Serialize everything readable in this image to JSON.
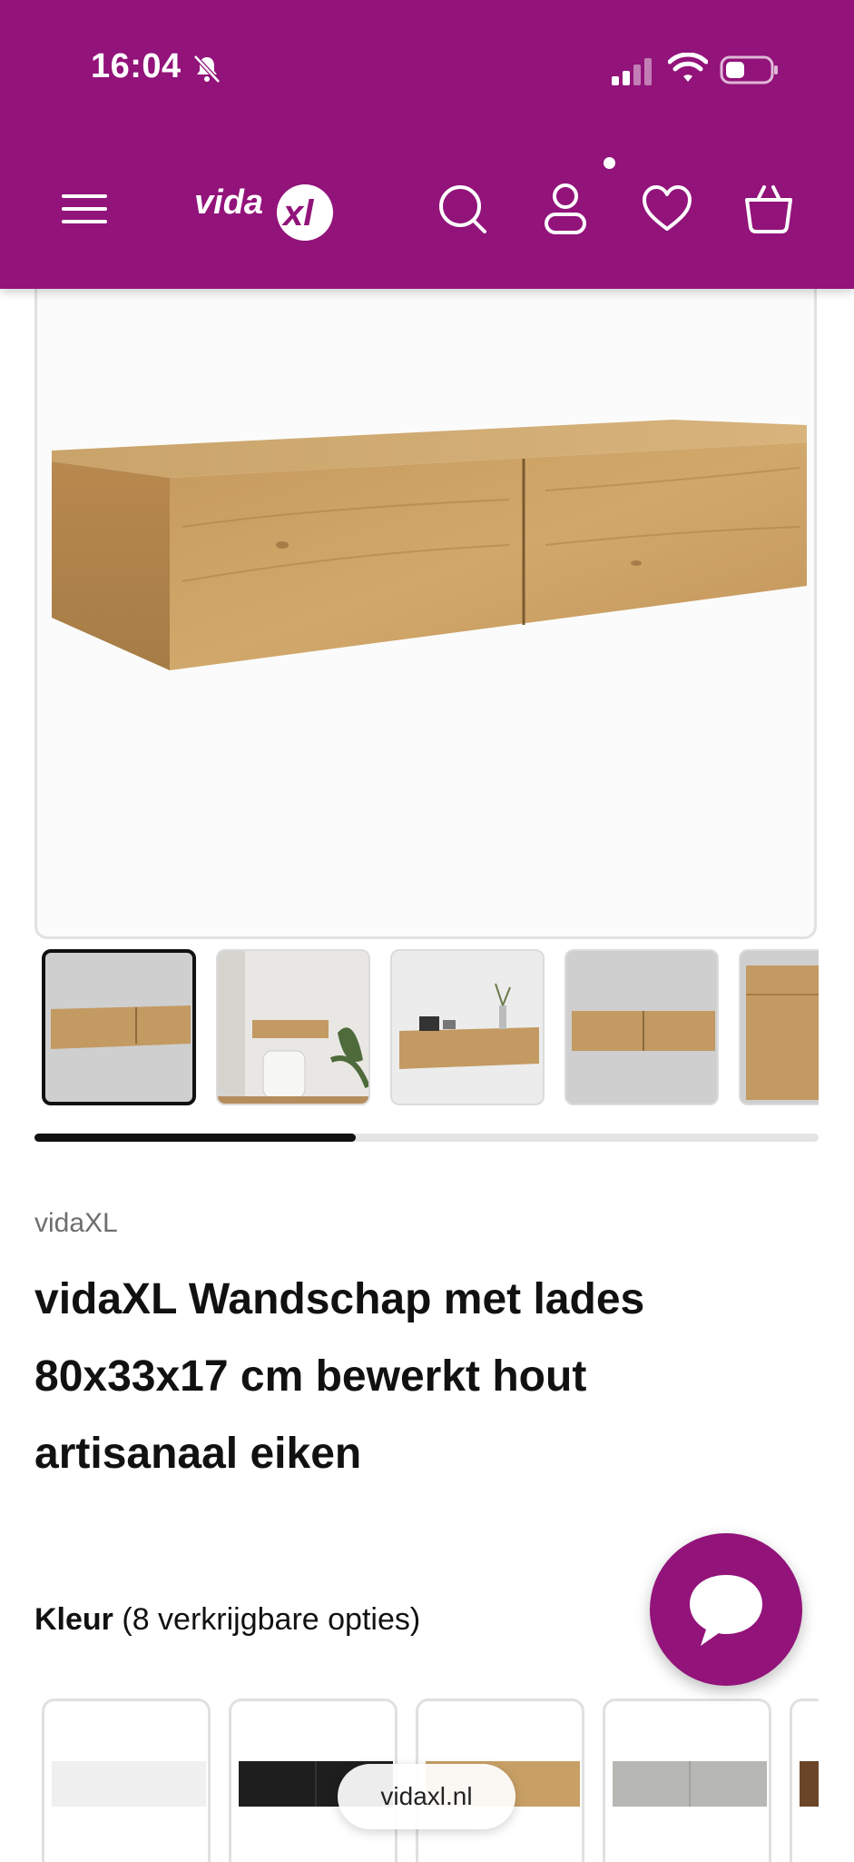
{
  "status_bar": {
    "time": "16:04"
  },
  "header": {
    "logo_text": "vidaXL",
    "icons": [
      "menu-icon",
      "search-icon",
      "account-icon",
      "wishlist-heart-icon",
      "cart-basket-icon"
    ],
    "brand_color": "#92137a"
  },
  "gallery": {
    "thumbnail_count_visible": 5,
    "active_index": 0,
    "scroll_progress": 0.41
  },
  "product": {
    "brand": "vidaXL",
    "title_lines": [
      "vidaXL Wandschap met lades",
      "80x33x17 cm bewerkt hout",
      "artisanaal eiken"
    ]
  },
  "options": {
    "label": "Kleur",
    "count_text": "(8 verkrijgbare opties)",
    "swatches": [
      "white",
      "black",
      "artisanal-oak",
      "concrete-grey",
      "smoked-oak"
    ]
  },
  "browser": {
    "url": "vidaxl.nl"
  }
}
